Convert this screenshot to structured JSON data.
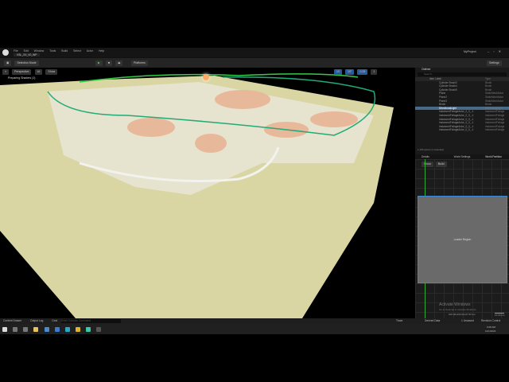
{
  "title_bar": {
    "menu": [
      "File",
      "Edit",
      "Window",
      "Tools",
      "Build",
      "Select",
      "Actor",
      "Help"
    ],
    "level_tab": "VSL_XX_V0_WP",
    "project": "MyProject"
  },
  "toolbar": {
    "mode": "Selection Mode",
    "platforms": "Platforms",
    "settings": "Settings"
  },
  "viewport": {
    "perspective": "Perspective",
    "lit": "Lit",
    "show": "Show",
    "status": "Preparing Shaders (1)",
    "grid": "10",
    "angle": "10°",
    "scale": "0.25",
    "camera_speed": "1"
  },
  "outliner": {
    "tab": "Outliner",
    "search_placeholder": "Search...",
    "col_label": "Item Label",
    "col_type": "Type",
    "rows": [
      {
        "label": "Cylinder Brush3",
        "type": "Brush"
      },
      {
        "label": "Cylinder Brush4",
        "type": "Brush"
      },
      {
        "label": "Cylinder Brush5",
        "type": "Brush"
      },
      {
        "label": "Plane",
        "type": "StaticMeshActor"
      },
      {
        "label": "Plane2",
        "type": "StaticMeshActor"
      },
      {
        "label": "Plane3",
        "type": "StaticMeshActor"
      },
      {
        "label": "Brush",
        "type": "Brush"
      },
      {
        "label": "DirectionalLight",
        "type": "DirectionalLight",
        "selected": true
      },
      {
        "label": "InstancedFoliageActor_0_0_-1",
        "type": "InstancedFoliage"
      },
      {
        "label": "InstancedFoliageActor_0_0_-1",
        "type": "InstancedFoliage"
      },
      {
        "label": "InstancedFoliageActor_0_0_-1",
        "type": "InstancedFoliage"
      },
      {
        "label": "InstancedFoliageActor_0_0_-1",
        "type": "InstancedFoliage"
      },
      {
        "label": "InstancedFoliageActor_0_0_-1",
        "type": "InstancedFoliage"
      },
      {
        "label": "InstancedFoliageActor_0_0_-1",
        "type": "InstancedFoliage"
      }
    ],
    "footer": "1,156 actors (1 selected)"
  },
  "tabs": [
    "Details",
    "World Settings",
    "World Partition"
  ],
  "world_partition": {
    "buttons": [
      "Show",
      "Build"
    ],
    "loader": "Loader Region",
    "coords": "200.00x200.00x37.50 km",
    "scale": "10.00 km",
    "watermark_title": "Activate Windows",
    "watermark_sub": "Go to Settings to activate Windows."
  },
  "status": {
    "content_drawer": "Content Drawer",
    "output_log": "Output Log",
    "cmd": "Cmd",
    "cmd_placeholder": "Enter Console Command",
    "trace": "Trace",
    "derived_data": "Derived Data",
    "unsaved": "1 Unsaved",
    "revision": "Revision Control"
  },
  "taskbar": {
    "time": "6:08 AM",
    "date": "12/1/2022"
  }
}
